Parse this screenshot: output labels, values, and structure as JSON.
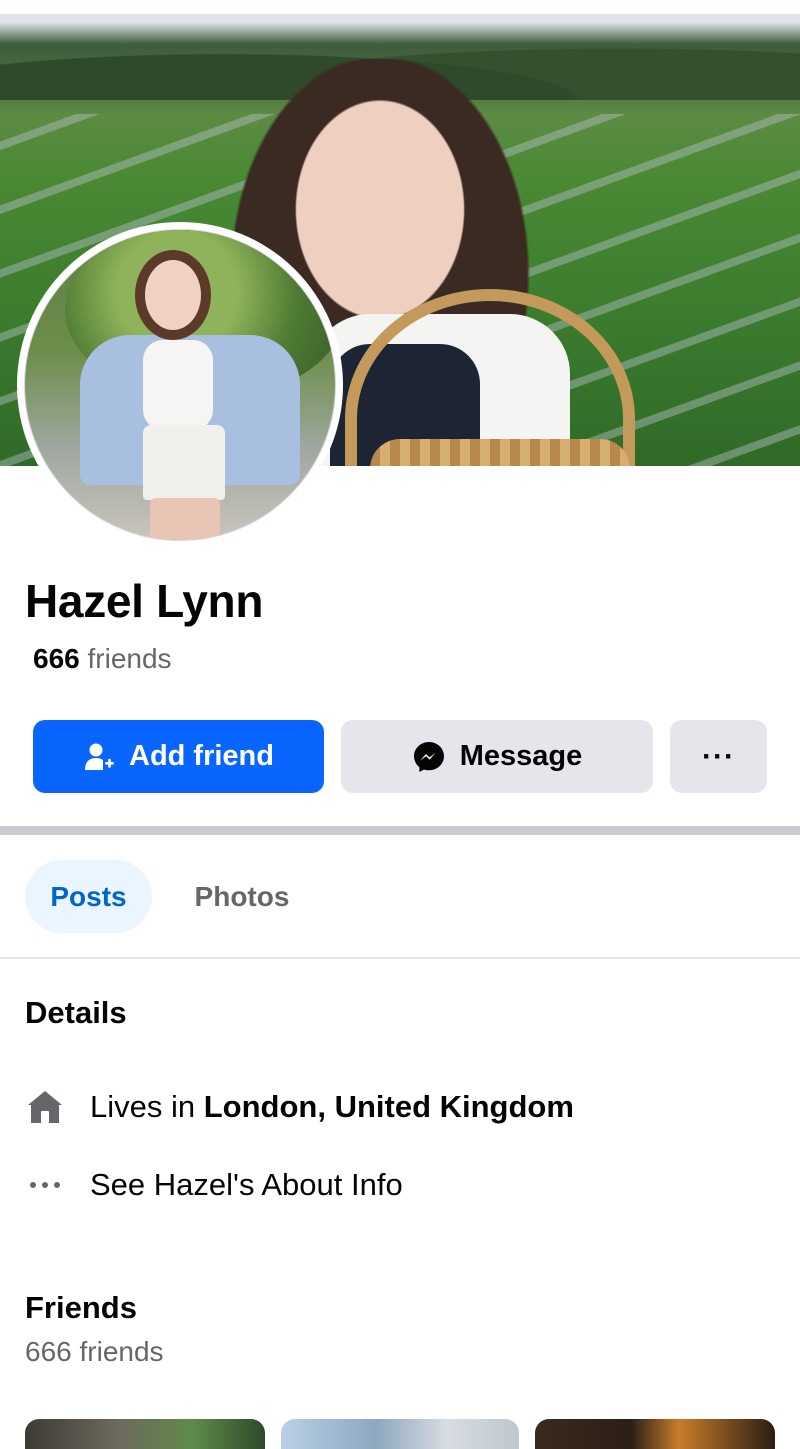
{
  "profile": {
    "name": "Hazel Lynn",
    "friend_count": "666",
    "friends_word": "friends"
  },
  "actions": {
    "add_friend": "Add friend",
    "message": "Message",
    "more": "···"
  },
  "tabs": [
    {
      "label": "Posts",
      "active": true
    },
    {
      "label": "Photos",
      "active": false
    }
  ],
  "details": {
    "heading": "Details",
    "lives_prefix": "Lives in",
    "lives_location": "London, United Kingdom",
    "about_link": "See Hazel's About Info"
  },
  "friends_section": {
    "heading": "Friends",
    "count_text": "666 friends"
  },
  "icons": {
    "add_friend": "person-add-icon",
    "message": "messenger-icon",
    "more": "more-dots-icon",
    "lives": "home-icon",
    "about": "more-dots-icon"
  },
  "colors": {
    "primary": "#0866ff",
    "secondary_button": "#e4e6eb",
    "active_tab_bg": "#ebf5ff",
    "active_tab_text": "#0064d1",
    "muted_text": "#65676b"
  }
}
